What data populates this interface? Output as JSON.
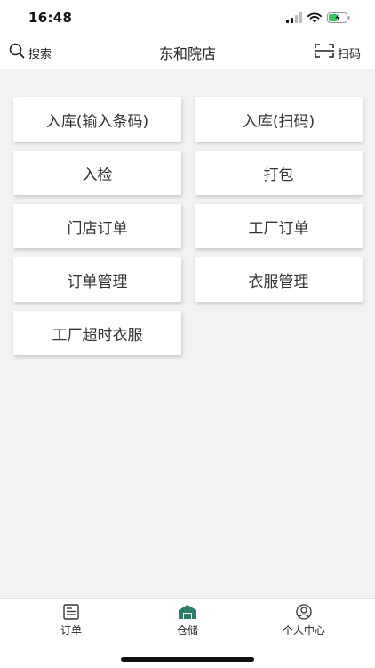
{
  "status_bar": {
    "time": "16:48"
  },
  "nav": {
    "search_label": "搜索",
    "title": "东和院店",
    "scan_label": "扫码",
    "search_icon": "search-icon",
    "scan_icon": "scan-icon"
  },
  "menu": {
    "items": [
      {
        "label": "入库(输入条码)"
      },
      {
        "label": "入库(扫码)"
      },
      {
        "label": "入检"
      },
      {
        "label": "打包"
      },
      {
        "label": "门店订单"
      },
      {
        "label": "工厂订单"
      },
      {
        "label": "订单管理"
      },
      {
        "label": "衣服管理"
      },
      {
        "label": "工厂超时衣服"
      }
    ]
  },
  "tabbar": {
    "tabs": [
      {
        "label": "订单",
        "icon": "document-icon",
        "active": false
      },
      {
        "label": "仓储",
        "icon": "warehouse-icon",
        "active": true
      },
      {
        "label": "个人中心",
        "icon": "user-icon",
        "active": false
      }
    ]
  },
  "colors": {
    "accent": "#2e7d6b",
    "background": "#f2f2f2",
    "tile": "#ffffff"
  }
}
